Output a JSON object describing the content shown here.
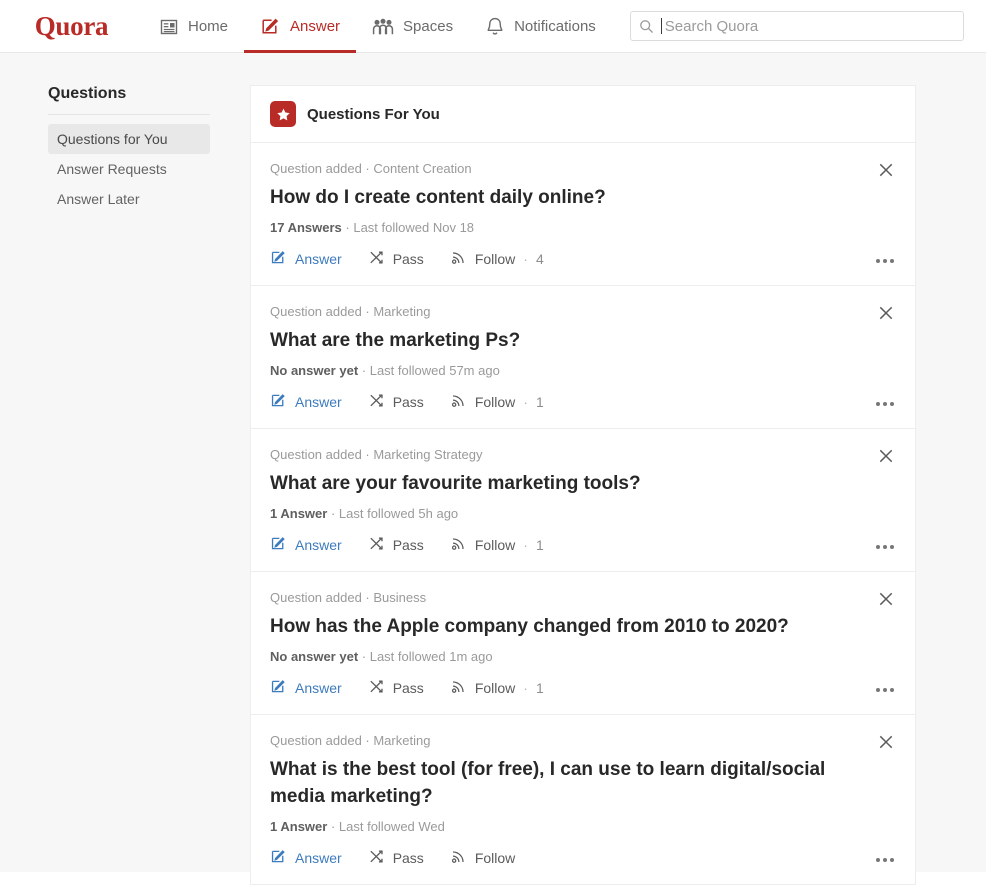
{
  "header": {
    "logo": "Quora",
    "nav": [
      {
        "label": "Home",
        "icon": "newspaper-icon",
        "active": false
      },
      {
        "label": "Answer",
        "icon": "pencil-square-icon",
        "active": true
      },
      {
        "label": "Spaces",
        "icon": "people-group-icon",
        "active": false
      },
      {
        "label": "Notifications",
        "icon": "bell-icon",
        "active": false
      }
    ],
    "search": {
      "placeholder": "Search Quora",
      "value": "",
      "icon": "search-icon"
    }
  },
  "sidebar": {
    "title": "Questions",
    "items": [
      {
        "label": "Questions for You",
        "selected": true
      },
      {
        "label": "Answer Requests",
        "selected": false
      },
      {
        "label": "Answer Later",
        "selected": false
      }
    ]
  },
  "main": {
    "card_title": "Questions For You",
    "card_icon": "star-badge-icon",
    "actions": {
      "answer": "Answer",
      "pass": "Pass",
      "follow": "Follow",
      "separator": "·",
      "close_icon": "close-icon",
      "more_icon": "more-options-icon"
    },
    "questions": [
      {
        "meta": "Question added · Content Creation",
        "title": "How do I create content daily online?",
        "answers": "17 Answers",
        "followed": "· Last followed Nov 18",
        "follow_count": "4"
      },
      {
        "meta": "Question added · Marketing",
        "title": "What are the marketing Ps?",
        "answers": "No answer yet",
        "followed": "· Last followed 57m ago",
        "follow_count": "1"
      },
      {
        "meta": "Question added · Marketing Strategy",
        "title": "What are your favourite marketing tools?",
        "answers": "1 Answer",
        "followed": "· Last followed 5h ago",
        "follow_count": "1"
      },
      {
        "meta": "Question added · Business",
        "title": "How has the Apple company changed from 2010 to 2020?",
        "answers": "No answer yet",
        "followed": "· Last followed 1m ago",
        "follow_count": "1"
      },
      {
        "meta": "Question added · Marketing",
        "title": "What is the best tool (for free), I can use to learn digital/social media marketing?",
        "answers": "1 Answer",
        "followed": "· Last followed Wed",
        "follow_count": ""
      }
    ]
  },
  "colors": {
    "brand_red": "#b92b27",
    "answer_blue": "#3d7bbd",
    "page_bg": "#f7f7f8",
    "text_dark": "#282829",
    "text_muted": "#9a9a9a"
  }
}
